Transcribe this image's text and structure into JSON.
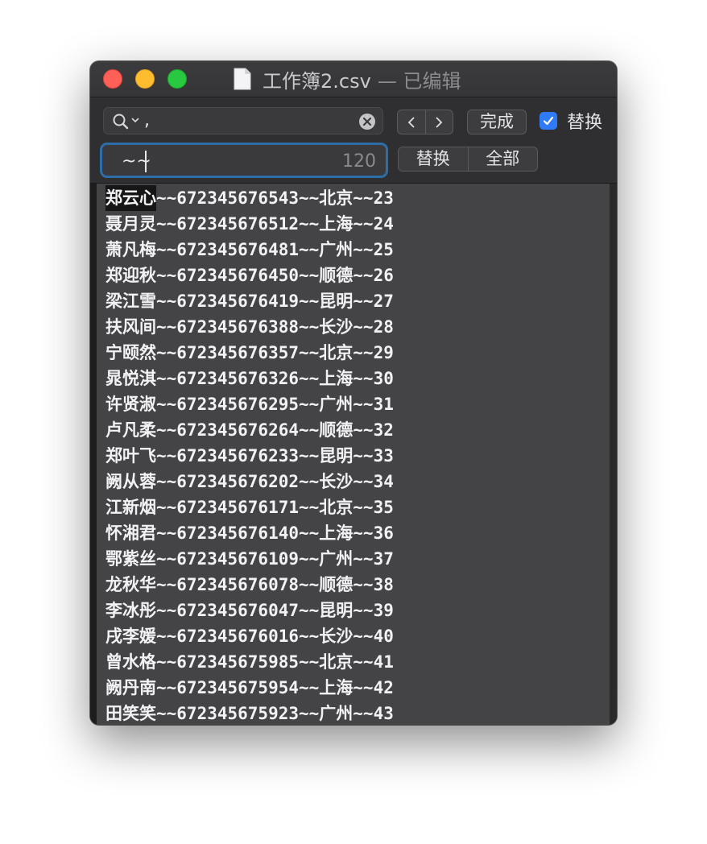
{
  "window": {
    "title": "工作簿2.csv",
    "status": "— 已编辑"
  },
  "find": {
    "search_value": ",",
    "replace_value": "~~",
    "replace_count": "120",
    "done_label": "完成",
    "replace_toggle_label": "替换",
    "replace_checked": true,
    "replace_button_label": "替换",
    "replace_all_label": "全部"
  },
  "editor": {
    "lines": [
      {
        "highlight": "郑云心",
        "rest": "~~672345676543~~北京~~23"
      },
      {
        "highlight": "",
        "rest": "聂月灵~~672345676512~~上海~~24"
      },
      {
        "highlight": "",
        "rest": "萧凡梅~~672345676481~~广州~~25"
      },
      {
        "highlight": "",
        "rest": "郑迎秋~~672345676450~~顺德~~26"
      },
      {
        "highlight": "",
        "rest": "梁江雪~~672345676419~~昆明~~27"
      },
      {
        "highlight": "",
        "rest": "扶风间~~672345676388~~长沙~~28"
      },
      {
        "highlight": "",
        "rest": "宁颐然~~672345676357~~北京~~29"
      },
      {
        "highlight": "",
        "rest": "晁悦淇~~672345676326~~上海~~30"
      },
      {
        "highlight": "",
        "rest": "许贤淑~~672345676295~~广州~~31"
      },
      {
        "highlight": "",
        "rest": "卢凡柔~~672345676264~~顺德~~32"
      },
      {
        "highlight": "",
        "rest": "郑叶飞~~672345676233~~昆明~~33"
      },
      {
        "highlight": "",
        "rest": "阙从蓉~~672345676202~~长沙~~34"
      },
      {
        "highlight": "",
        "rest": "江新烟~~672345676171~~北京~~35"
      },
      {
        "highlight": "",
        "rest": "怀湘君~~672345676140~~上海~~36"
      },
      {
        "highlight": "",
        "rest": "鄂紫丝~~672345676109~~广州~~37"
      },
      {
        "highlight": "",
        "rest": "龙秋华~~672345676078~~顺德~~38"
      },
      {
        "highlight": "",
        "rest": "李冰彤~~672345676047~~昆明~~39"
      },
      {
        "highlight": "",
        "rest": "戌李媛~~672345676016~~长沙~~40"
      },
      {
        "highlight": "",
        "rest": "曾水格~~672345675985~~北京~~41"
      },
      {
        "highlight": "",
        "rest": "阙丹南~~672345675954~~上海~~42"
      },
      {
        "highlight": "",
        "rest": "田笑笑~~672345675923~~广州~~43"
      }
    ]
  },
  "colors": {
    "close": "#fe5f57",
    "minimize": "#febc2e",
    "maximize": "#28c840",
    "checkbox": "#2f7bf5",
    "focus_ring": "#2e6ea8"
  },
  "icons": {
    "document": "document-icon",
    "search": "search-icon",
    "clear": "clear-icon",
    "previous": "chevron-left-icon",
    "next": "chevron-right-icon",
    "check": "checkmark-icon"
  }
}
